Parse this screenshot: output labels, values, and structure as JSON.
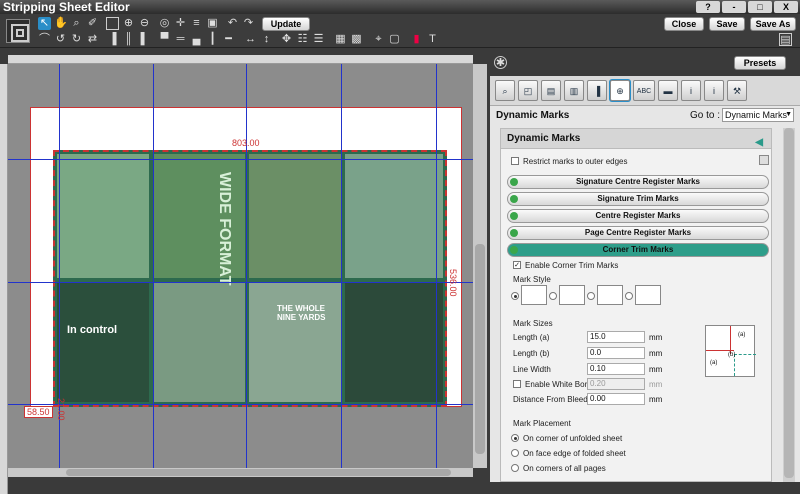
{
  "app": {
    "title": "Stripping Sheet Editor"
  },
  "window_buttons": [
    "?",
    "-",
    "□",
    "X"
  ],
  "toolbar": {
    "update_label": "Update",
    "close_label": "Close",
    "save_label": "Save",
    "save_as_label": "Save As"
  },
  "canvas": {
    "dim_width": "803.00",
    "dim_height": "536.00",
    "dim_left": "58.50",
    "dim_bottom": "21.00",
    "page_headlines": [
      "WIDE FORMAT",
      "In control",
      "THE WHOLE NINE YARDS"
    ]
  },
  "panel": {
    "presets_label": "Presets",
    "title": "Dynamic Marks",
    "goto_label": "Go to :",
    "goto_value": "Dynamic Marks",
    "section_title": "Dynamic Marks",
    "restrict_label": "Restrict marks to outer edges",
    "marks": [
      "Signature Centre Register Marks",
      "Signature Trim Marks",
      "Centre Register Marks",
      "Page Centre Register Marks",
      "Corner Trim Marks"
    ],
    "enable_label": "Enable Corner Trim Marks",
    "mark_style_label": "Mark Style",
    "mark_sizes_label": "Mark Sizes",
    "sizes": [
      {
        "label": "Length (a)",
        "value": "15.0",
        "unit": "mm"
      },
      {
        "label": "Length (b)",
        "value": "0.0",
        "unit": "mm"
      },
      {
        "label": "Line Width",
        "value": "0.10",
        "unit": "mm"
      }
    ],
    "white_border_label": "Enable White Border",
    "white_border_value": "0.20",
    "white_border_unit": "mm",
    "distance_label": "Distance From Bleed",
    "distance_value": "0.00",
    "distance_unit": "mm",
    "placement_label": "Mark Placement",
    "placement_options": [
      "On corner of unfolded sheet",
      "On face edge of folded sheet",
      "On corners of all pages"
    ],
    "diagram_labels": [
      "(a)",
      "(b)",
      "(a)"
    ]
  }
}
